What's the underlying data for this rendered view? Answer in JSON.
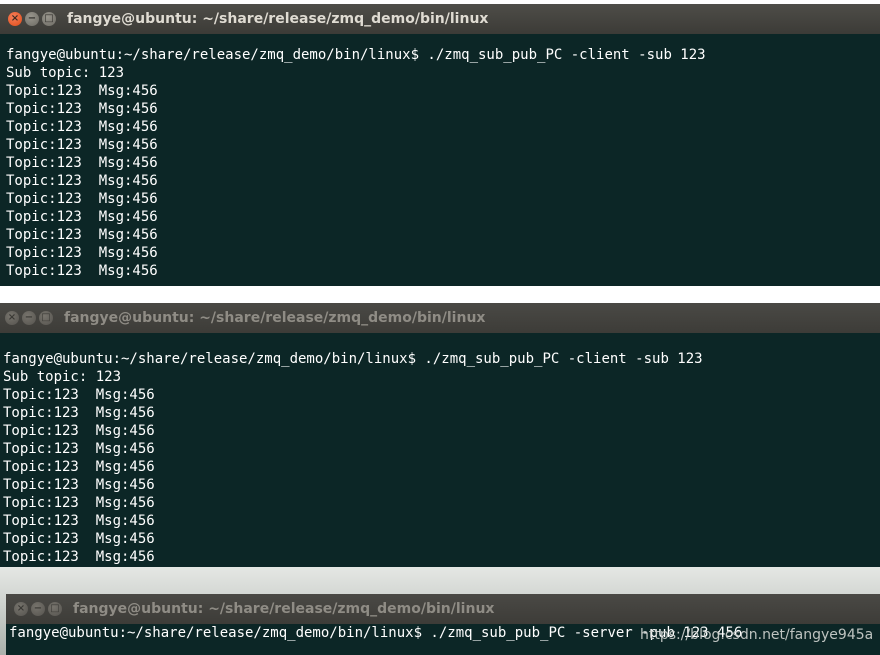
{
  "windows": [
    {
      "title": "fangye@ubuntu: ~/share/release/zmq_demo/bin/linux",
      "lines": [
        "fangye@ubuntu:~/share/release/zmq_demo/bin/linux$ ./zmq_sub_pub_PC -client -sub 123",
        "Sub topic: 123",
        "Topic:123  Msg:456",
        "Topic:123  Msg:456",
        "Topic:123  Msg:456",
        "Topic:123  Msg:456",
        "Topic:123  Msg:456",
        "Topic:123  Msg:456",
        "Topic:123  Msg:456",
        "Topic:123  Msg:456",
        "Topic:123  Msg:456",
        "Topic:123  Msg:456",
        "Topic:123  Msg:456"
      ]
    },
    {
      "title": "fangye@ubuntu: ~/share/release/zmq_demo/bin/linux",
      "lines": [
        "fangye@ubuntu:~/share/release/zmq_demo/bin/linux$ ./zmq_sub_pub_PC -client -sub 123",
        "Sub topic: 123",
        "Topic:123  Msg:456",
        "Topic:123  Msg:456",
        "Topic:123  Msg:456",
        "Topic:123  Msg:456",
        "Topic:123  Msg:456",
        "Topic:123  Msg:456",
        "Topic:123  Msg:456",
        "Topic:123  Msg:456",
        "Topic:123  Msg:456",
        "Topic:123  Msg:456"
      ]
    },
    {
      "title": "fangye@ubuntu: ~/share/release/zmq_demo/bin/linux",
      "lines": [
        "fangye@ubuntu:~/share/release/zmq_demo/bin/linux$ ./zmq_sub_pub_PC -server -pub 123 456"
      ]
    }
  ],
  "window_controls": {
    "close": "×",
    "minimize": "−",
    "maximize": "□"
  },
  "watermark": "https://blog.csdn.net/fangye945a"
}
